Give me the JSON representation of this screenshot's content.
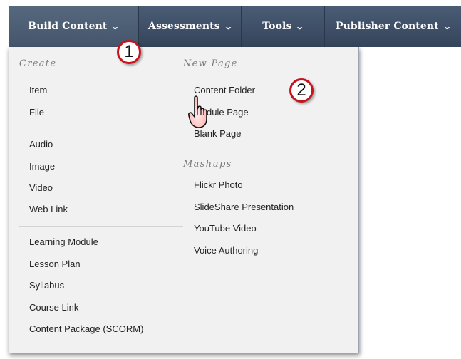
{
  "menubar": {
    "build_content": "Build Content",
    "assessments": "Assessments",
    "tools": "Tools",
    "publisher_content": "Publisher Content",
    "caret": "⌄"
  },
  "dropdown": {
    "create_heading": "Create",
    "create_items": [
      "Item",
      "File",
      "Audio",
      "Image",
      "Video",
      "Web Link",
      "Learning Module",
      "Lesson Plan",
      "Syllabus",
      "Course Link",
      "Content Package (SCORM)"
    ],
    "new_page_heading": "New Page",
    "new_page_items": [
      "Content Folder",
      "Module Page",
      "Blank Page"
    ],
    "mashups_heading": "Mashups",
    "mashups_items": [
      "Flickr Photo",
      "SlideShare Presentation",
      "YouTube Video",
      "Voice Authoring"
    ]
  },
  "callouts": {
    "one": "1",
    "two": "2"
  },
  "colors": {
    "menubar": "#3f5068",
    "panel": "#f1f1f1",
    "callout_border": "#c8131b"
  }
}
